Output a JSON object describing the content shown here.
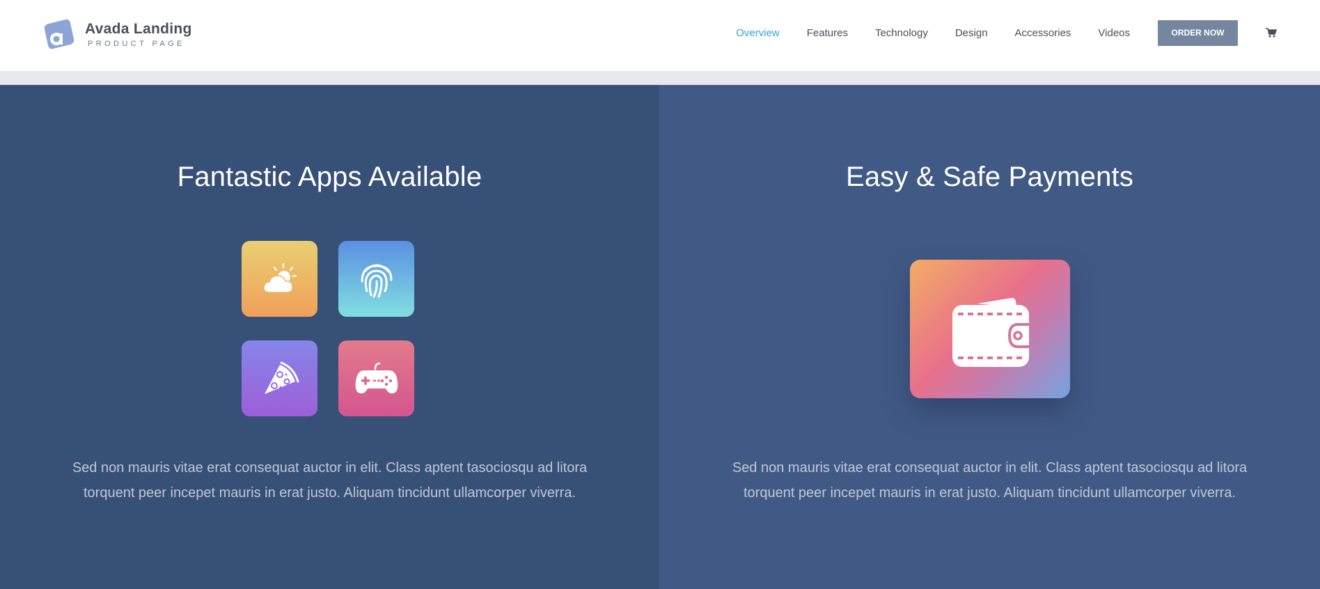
{
  "header": {
    "logo_title": "Avada Landing",
    "logo_subtitle": "PRODUCT PAGE",
    "nav": [
      {
        "label": "Overview",
        "active": true
      },
      {
        "label": "Features",
        "active": false
      },
      {
        "label": "Technology",
        "active": false
      },
      {
        "label": "Design",
        "active": false
      },
      {
        "label": "Accessories",
        "active": false
      },
      {
        "label": "Videos",
        "active": false
      }
    ],
    "order_button": "ORDER NOW",
    "cart_icon": "shopping-cart-icon"
  },
  "left_panel": {
    "title": "Fantastic Apps Available",
    "apps": [
      {
        "icon": "weather-icon"
      },
      {
        "icon": "fingerprint-icon"
      },
      {
        "icon": "pizza-icon"
      },
      {
        "icon": "gamepad-icon"
      }
    ],
    "text_line1": "Sed non mauris vitae erat consequat auctor in elit. Class aptent tasociosqu ad litora",
    "text_line2": "torquent peer incepet mauris in erat justo. Aliquam tincidunt ullamcorper viverra."
  },
  "right_panel": {
    "title": "Easy & Safe Payments",
    "icon": "wallet-icon",
    "text_line1": "Sed non mauris vitae erat consequat auctor in elit. Class aptent tasociosqu ad litora",
    "text_line2": "torquent peer incepet mauris in erat justo. Aliquam tincidunt ullamcorper viverra."
  },
  "colors": {
    "accent": "#2ba9d6",
    "button": "#7587a0",
    "left_bg": "#375077",
    "right_bg": "#415a85"
  }
}
